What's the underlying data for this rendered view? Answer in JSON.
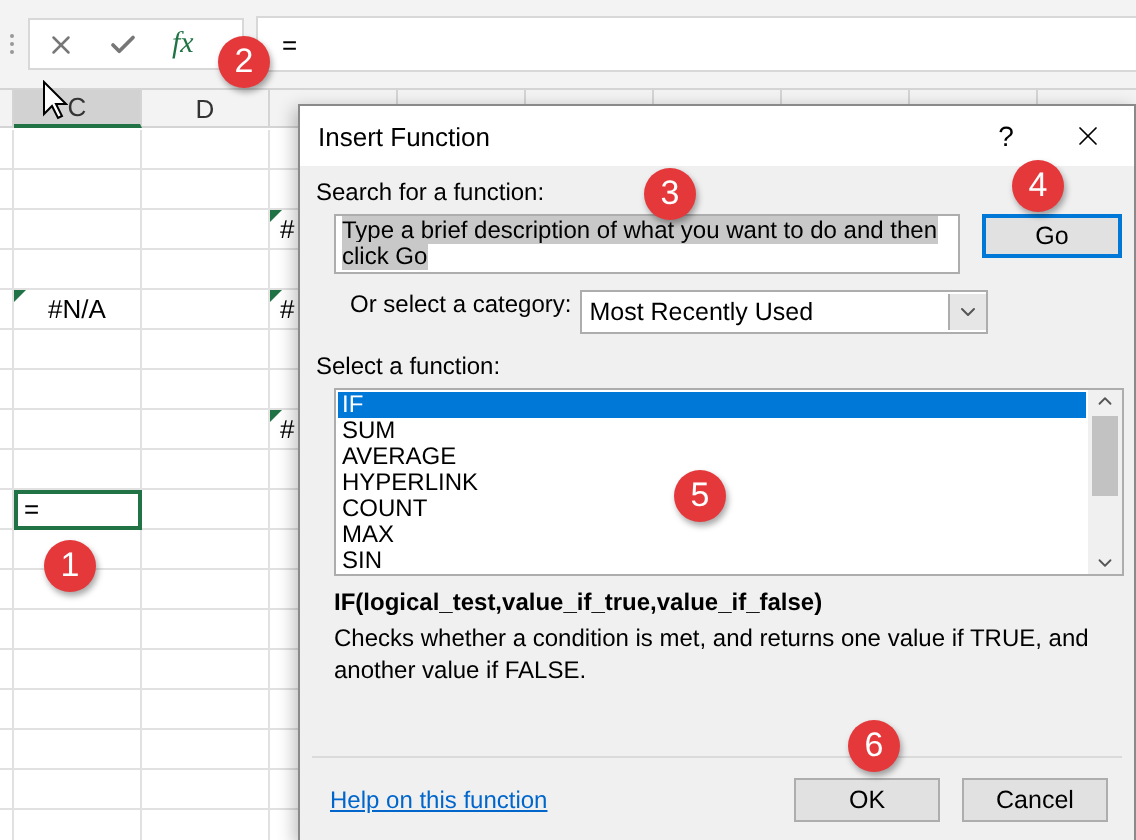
{
  "formula_bar": {
    "function_label": "fx",
    "value": "="
  },
  "column_headers": [
    {
      "label": "C",
      "selected": true
    },
    {
      "label": "D",
      "selected": false
    }
  ],
  "rows": [
    {
      "cells": [
        {
          "selected": false,
          "error": false
        },
        {
          "selected": false,
          "error": false
        },
        {
          "selected": false,
          "error": false
        }
      ]
    },
    {
      "cells": [
        {
          "selected": false,
          "error": false
        },
        {
          "selected": false,
          "error": false
        },
        {
          "selected": false,
          "error": false
        }
      ]
    },
    {
      "cells": [
        {
          "selected": false,
          "error": false
        },
        {
          "selected": false,
          "error": false
        },
        {
          "selected": false,
          "error": true,
          "text": "#"
        }
      ]
    },
    {
      "cells": [
        {
          "selected": false,
          "error": false
        },
        {
          "selected": false,
          "error": false
        },
        {
          "selected": false,
          "error": false
        }
      ]
    },
    {
      "cells": [
        {
          "selected": false,
          "error": true,
          "text": "#N/A"
        },
        {
          "selected": false,
          "error": false
        },
        {
          "selected": false,
          "error": true,
          "text": "#"
        }
      ]
    },
    {
      "cells": [
        {
          "selected": false,
          "error": false
        },
        {
          "selected": false,
          "error": false
        },
        {
          "selected": false,
          "error": false
        }
      ]
    },
    {
      "cells": [
        {
          "selected": false,
          "error": false
        },
        {
          "selected": false,
          "error": false
        },
        {
          "selected": false,
          "error": false
        }
      ]
    },
    {
      "cells": [
        {
          "selected": false,
          "error": false
        },
        {
          "selected": false,
          "error": false
        },
        {
          "selected": false,
          "error": true,
          "text": "#"
        }
      ]
    },
    {
      "cells": [
        {
          "selected": false,
          "error": false
        },
        {
          "selected": false,
          "error": false
        },
        {
          "selected": false,
          "error": false
        }
      ]
    },
    {
      "cells": [
        {
          "selected": true,
          "error": false,
          "text": "="
        },
        {
          "selected": false,
          "error": false
        },
        {
          "selected": false,
          "error": false
        }
      ]
    },
    {
      "cells": [
        {
          "selected": false,
          "error": false
        },
        {
          "selected": false,
          "error": false
        },
        {
          "selected": false,
          "error": false
        }
      ]
    },
    {
      "cells": [
        {
          "selected": false,
          "error": false
        },
        {
          "selected": false,
          "error": false
        },
        {
          "selected": false,
          "error": false
        }
      ]
    },
    {
      "cells": [
        {
          "selected": false,
          "error": false
        },
        {
          "selected": false,
          "error": false
        },
        {
          "selected": false,
          "error": false
        }
      ]
    },
    {
      "cells": [
        {
          "selected": false,
          "error": false
        },
        {
          "selected": false,
          "error": false
        },
        {
          "selected": false,
          "error": false
        }
      ]
    },
    {
      "cells": [
        {
          "selected": false,
          "error": false
        },
        {
          "selected": false,
          "error": false
        },
        {
          "selected": false,
          "error": false
        }
      ]
    },
    {
      "cells": [
        {
          "selected": false,
          "error": false
        },
        {
          "selected": false,
          "error": false
        },
        {
          "selected": false,
          "error": false
        }
      ]
    },
    {
      "cells": [
        {
          "selected": false,
          "error": false
        },
        {
          "selected": false,
          "error": false
        },
        {
          "selected": false,
          "error": false
        }
      ]
    },
    {
      "cells": [
        {
          "selected": false,
          "error": false
        },
        {
          "selected": false,
          "error": false
        },
        {
          "selected": false,
          "error": false
        }
      ]
    }
  ],
  "dialog": {
    "title": "Insert Function",
    "help": "?",
    "search_label": "Search for a function:",
    "search_value": "Type a brief description of what you want to do and then click Go",
    "go_button": "Go",
    "category_label": "Or select a category:",
    "category_value": "Most Recently Used",
    "list_label": "Select a function:",
    "functions": [
      {
        "name": "IF",
        "selected": true
      },
      {
        "name": "SUM",
        "selected": false
      },
      {
        "name": "AVERAGE",
        "selected": false
      },
      {
        "name": "HYPERLINK",
        "selected": false
      },
      {
        "name": "COUNT",
        "selected": false
      },
      {
        "name": "MAX",
        "selected": false
      },
      {
        "name": "SIN",
        "selected": false
      }
    ],
    "signature": "IF(logical_test,value_if_true,value_if_false)",
    "description": "Checks whether a condition is met, and returns one value if TRUE, and another value if FALSE.",
    "help_link": "Help on this function",
    "ok_button": "OK",
    "cancel_button": "Cancel"
  },
  "callouts": [
    "1",
    "2",
    "3",
    "4",
    "5",
    "6"
  ]
}
